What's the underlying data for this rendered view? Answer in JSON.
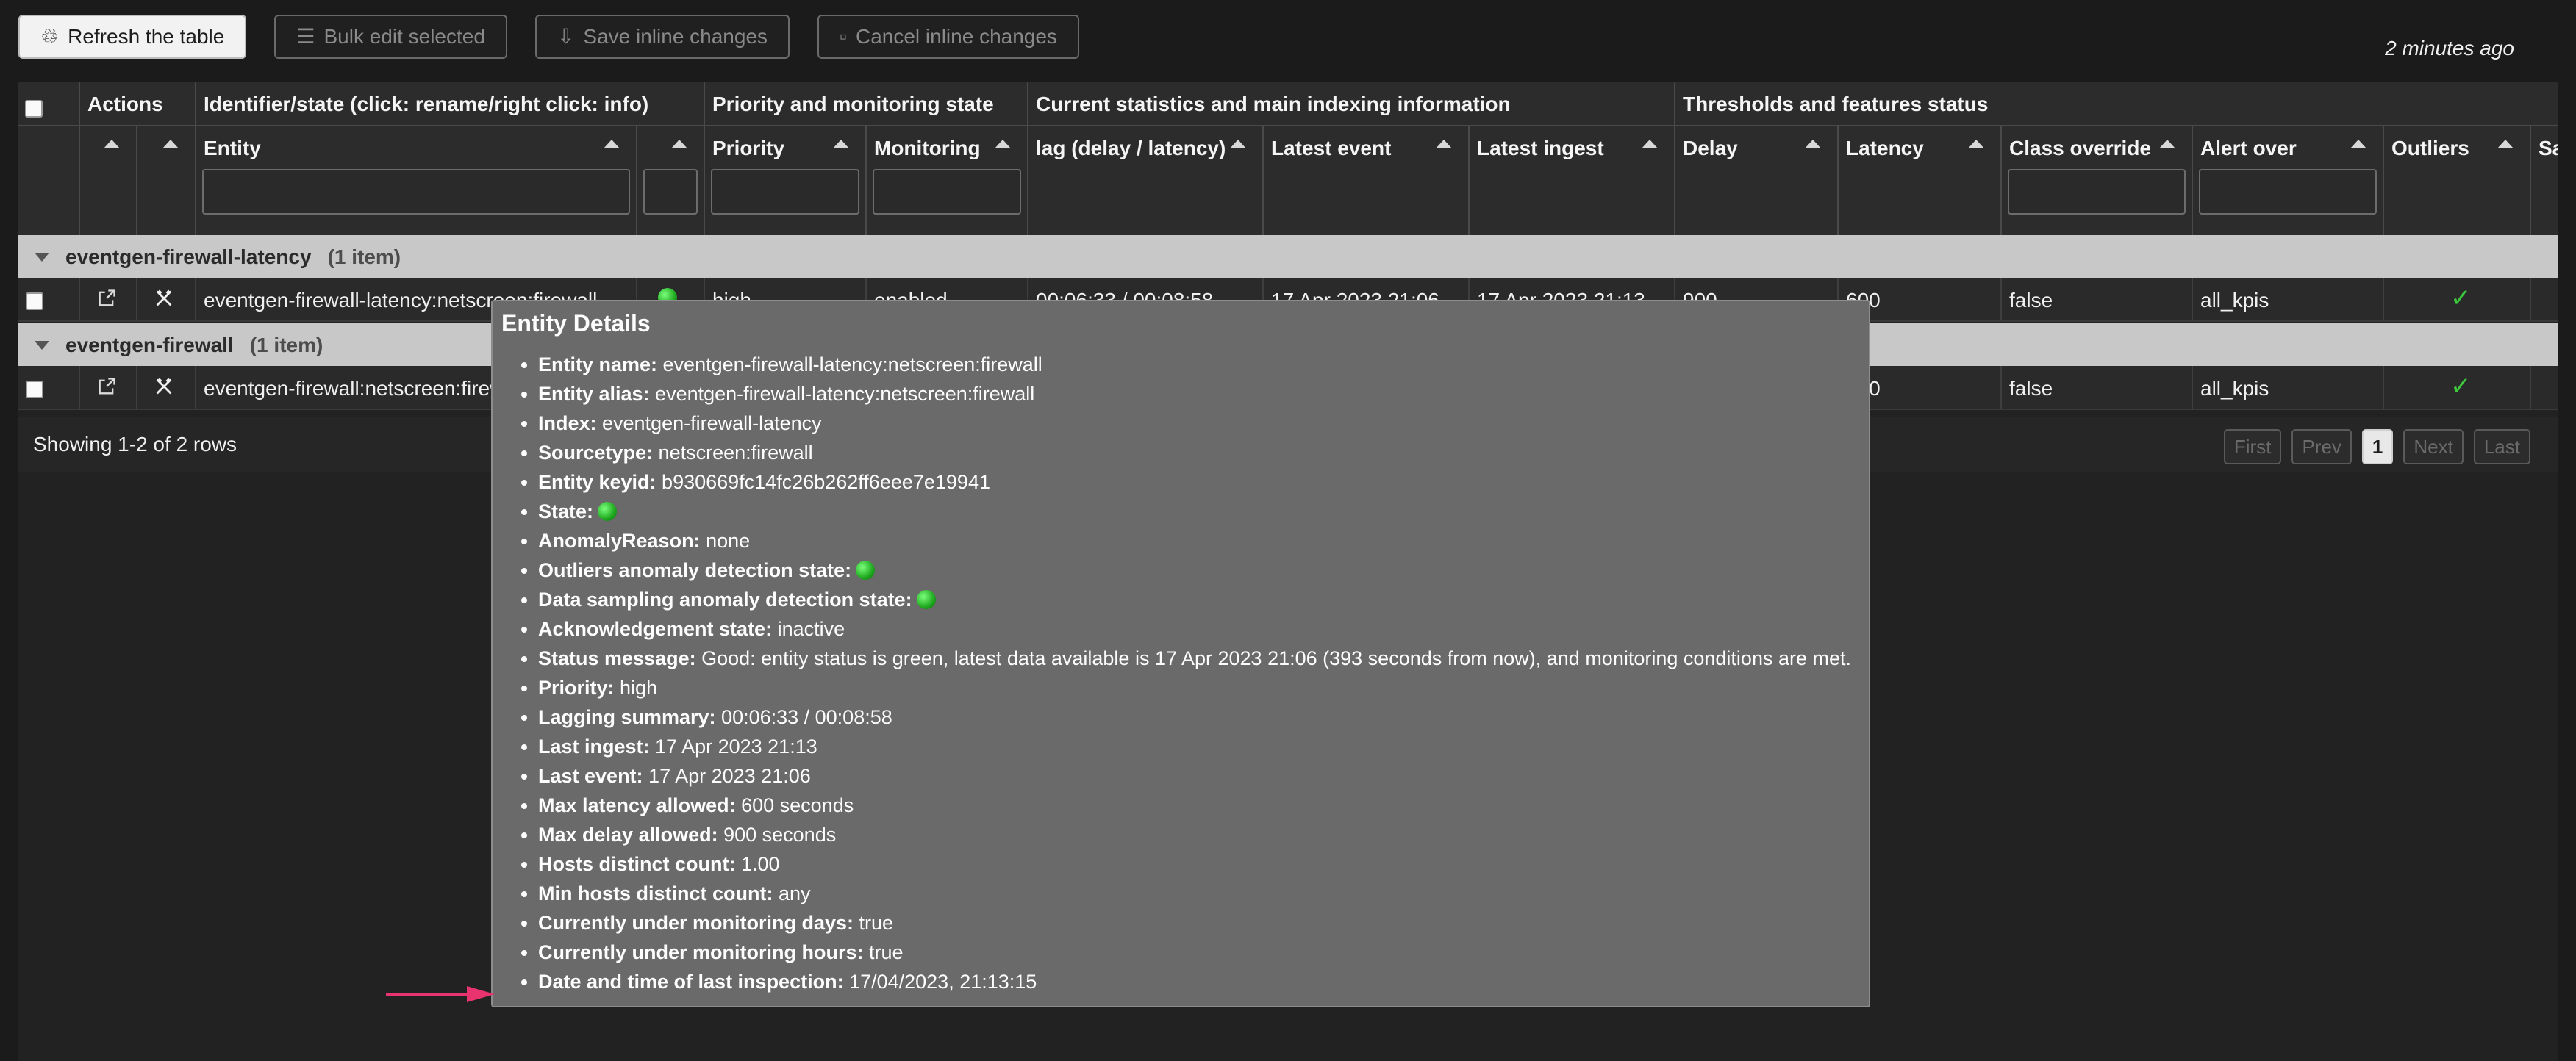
{
  "toolbar": {
    "refresh": "Refresh the table",
    "bulk_edit": "Bulk edit selected",
    "save_inline": "Save inline changes",
    "cancel_inline": "Cancel inline changes",
    "last_updated": "2 minutes ago"
  },
  "header_groups": {
    "actions": "Actions",
    "identifier": "Identifier/state (click: rename/right click: info)",
    "priority_monitoring": "Priority and monitoring state",
    "stats": "Current statistics and main indexing information",
    "thresholds": "Thresholds and features status"
  },
  "columns": {
    "entity": "Entity",
    "priority": "Priority",
    "monitoring": "Monitoring",
    "lag": "lag (delay / latency)",
    "latest_event": "Latest event",
    "latest_ingest": "Latest ingest",
    "delay": "Delay",
    "latency": "Latency",
    "class_override": "Class override",
    "alert_over": "Alert over",
    "outliers": "Outliers",
    "sa": "Sa"
  },
  "groups": [
    {
      "name": "eventgen-firewall-latency",
      "count": "(1 item)",
      "row": {
        "entity": "eventgen-firewall-latency:netscreen:firewall",
        "priority": "high",
        "monitoring": "enabled",
        "lag": "00:06:33 / 00:08:58",
        "latest_event": "17 Apr 2023 21:06",
        "latest_ingest": "17 Apr 2023 21:13",
        "delay": "900",
        "latency": "600",
        "class_override": "false",
        "alert_over": "all_kpis"
      }
    },
    {
      "name": "eventgen-firewall",
      "count": "(1 item)",
      "row": {
        "entity": "eventgen-firewall:netscreen:firewall",
        "latency": "600",
        "class_override": "false",
        "alert_over": "all_kpis"
      }
    }
  ],
  "footer": {
    "showing": "Showing 1-2 of 2 rows",
    "first": "First",
    "prev": "Prev",
    "page": "1",
    "next": "Next",
    "last": "Last"
  },
  "tooltip": {
    "title": "Entity Details",
    "items": [
      {
        "label": "Entity name:",
        "value": " eventgen-firewall-latency:netscreen:firewall"
      },
      {
        "label": "Entity alias:",
        "value": " eventgen-firewall-latency:netscreen:firewall"
      },
      {
        "label": "Index:",
        "value": " eventgen-firewall-latency"
      },
      {
        "label": "Sourcetype:",
        "value": " netscreen:firewall"
      },
      {
        "label": "Entity keyid:",
        "value": " b930669fc14fc26b262ff6eee7e19941"
      },
      {
        "label": "State:",
        "value": "",
        "dot": true
      },
      {
        "label": "AnomalyReason:",
        "value": " none"
      },
      {
        "label": "Outliers anomaly detection state:",
        "value": "",
        "dot": true
      },
      {
        "label": "Data sampling anomaly detection state:",
        "value": "",
        "dot": true
      },
      {
        "label": "Acknowledgement state:",
        "value": " inactive"
      },
      {
        "label": "Status message:",
        "value": " Good: entity status is green, latest data available is 17 Apr 2023 21:06 (393 seconds from now), and monitoring conditions are met."
      },
      {
        "label": "Priority:",
        "value": " high"
      },
      {
        "label": "Lagging summary:",
        "value": " 00:06:33 / 00:08:58"
      },
      {
        "label": "Last ingest:",
        "value": " 17 Apr 2023 21:13"
      },
      {
        "label": "Last event:",
        "value": " 17 Apr 2023 21:06"
      },
      {
        "label": "Max latency allowed:",
        "value": " 600 seconds"
      },
      {
        "label": "Max delay allowed:",
        "value": " 900 seconds"
      },
      {
        "label": "Hosts distinct count:",
        "value": " 1.00"
      },
      {
        "label": "Min hosts distinct count:",
        "value": " any"
      },
      {
        "label": "Currently under monitoring days:",
        "value": " true"
      },
      {
        "label": "Currently under monitoring hours:",
        "value": " true"
      },
      {
        "label": "Date and time of last inspection:",
        "value": " 17/04/2023, 21:13:15"
      }
    ]
  },
  "colors": {
    "state_green": "#1fa81f",
    "check_green": "#3cc83c",
    "annotation_arrow": "#e8336e"
  }
}
